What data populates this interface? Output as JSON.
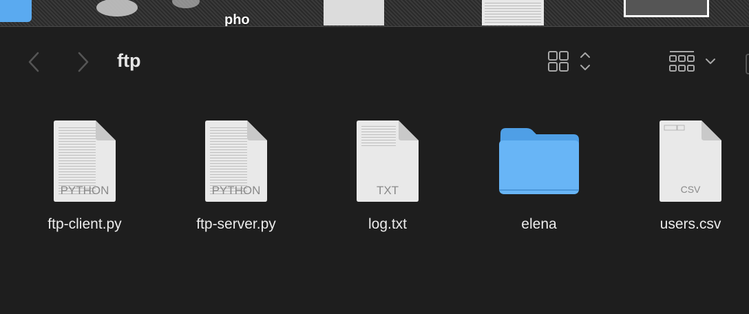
{
  "desktop": {
    "partial_label": "pho"
  },
  "toolbar": {
    "title": "ftp"
  },
  "items": [
    {
      "name": "ftp-client.py",
      "kind": "file",
      "ext_badge": "PYTHON",
      "icon": "python-document-icon"
    },
    {
      "name": "ftp-server.py",
      "kind": "file",
      "ext_badge": "PYTHON",
      "icon": "python-document-icon"
    },
    {
      "name": "log.txt",
      "kind": "file",
      "ext_badge": "TXT",
      "icon": "text-document-icon"
    },
    {
      "name": "elena",
      "kind": "folder",
      "icon": "folder-icon"
    },
    {
      "name": "users.csv",
      "kind": "file",
      "ext_badge": "CSV",
      "icon": "csv-document-icon"
    }
  ],
  "colors": {
    "window_bg": "#1e1e1e",
    "folder_blue": "#5aaaf0",
    "text": "#ececec"
  }
}
